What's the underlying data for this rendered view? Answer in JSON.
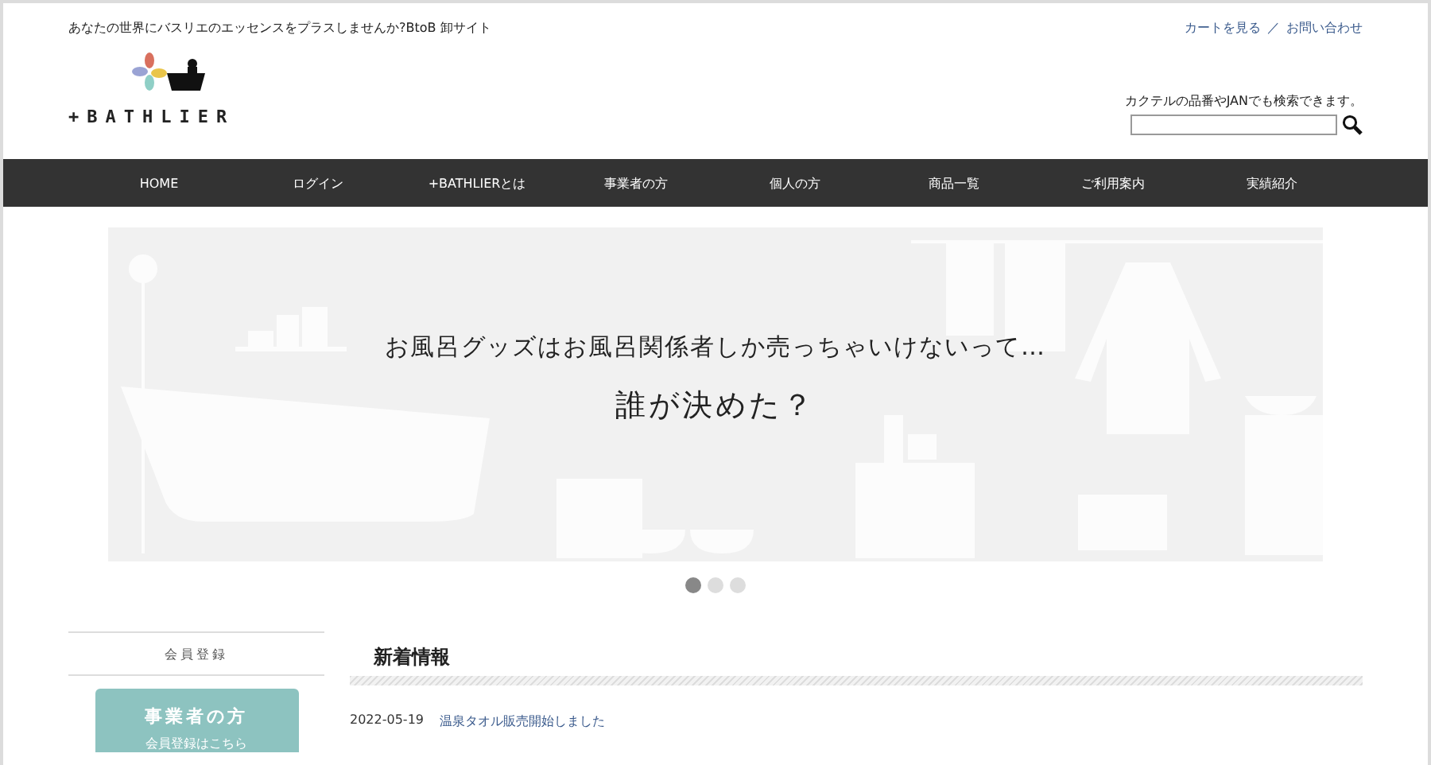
{
  "header": {
    "tagline": "あなたの世界にバスリエのエッセンスをプラスしませんか?BtoB 卸サイト",
    "logo": "+BATHLIER",
    "links": [
      {
        "label": "カートを見る"
      },
      {
        "label": "お問い合わせ"
      }
    ],
    "link_separator": "／",
    "search": {
      "hint": "カクテルの品番やJANでも検索できます。"
    }
  },
  "nav": [
    {
      "label": "HOME"
    },
    {
      "label": "ログイン"
    },
    {
      "label": "+BATHLIERとは"
    },
    {
      "label": "事業者の方"
    },
    {
      "label": "個人の方"
    },
    {
      "label": "商品一覧"
    },
    {
      "label": "ご利用案内"
    },
    {
      "label": "実績紹介"
    }
  ],
  "banner": {
    "line_1": "お風呂グッズはお風呂関係者しか売っちゃいけないって…",
    "line_2": "誰が決めた？"
  },
  "carousel_dots": [
    {
      "selected": true
    },
    {
      "selected": false
    },
    {
      "selected": false
    }
  ],
  "sidebar": {
    "heading": "会員登録",
    "button": {
      "title": "事業者の方",
      "subtitle": "会員登録はこちら"
    }
  },
  "news": {
    "heading": "新着情報",
    "items": [
      {
        "date": "2022-05-19",
        "title": "温泉タオル販売開始しました"
      }
    ]
  }
}
